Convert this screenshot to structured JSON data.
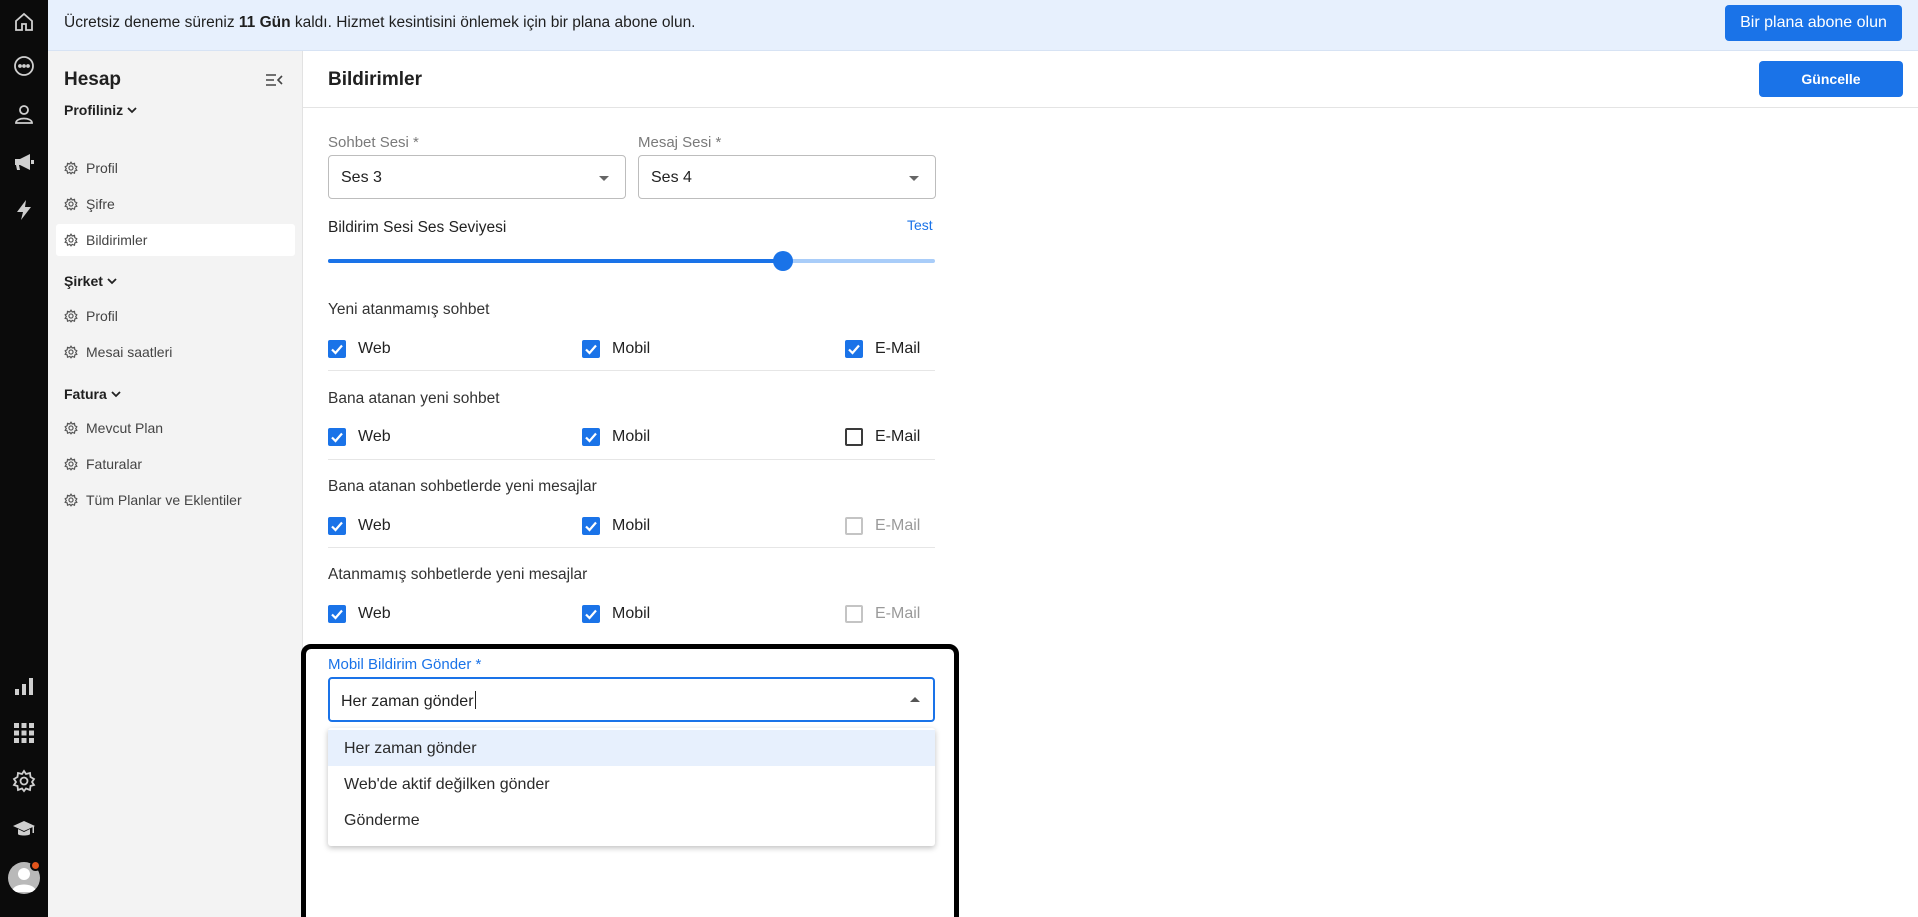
{
  "banner": {
    "text_before": "Ücretsiz deneme süreniz ",
    "days": "11 Gün",
    "text_after": " kaldı. Hizmet kesintisini önlemek için bir plana abone olun.",
    "button": "Bir plana abone olun"
  },
  "rail": {
    "icons": [
      "home-icon",
      "chat-icon",
      "user-icon",
      "megaphone-icon",
      "bolt-icon",
      "bar-chart-icon",
      "apps-grid-icon",
      "settings-gear-icon",
      "graduation-cap-icon",
      "avatar"
    ]
  },
  "sidebar": {
    "title": "Hesap",
    "sections": [
      {
        "label": "Profiliniz",
        "items": [
          "Profil",
          "Şifre",
          "Bildirimler"
        ]
      },
      {
        "label": "Şirket",
        "items": [
          "Profil",
          "Mesai saatleri"
        ]
      },
      {
        "label": "Fatura",
        "items": [
          "Mevcut Plan",
          "Faturalar",
          "Tüm Planlar ve Eklentiler"
        ]
      }
    ],
    "active_item": "Bildirimler"
  },
  "main": {
    "title": "Bildirimler",
    "update_button": "Güncelle",
    "chat_sound": {
      "label": "Sohbet Sesi *",
      "value": "Ses 3"
    },
    "message_sound": {
      "label": "Mesaj Sesi *",
      "value": "Ses 4"
    },
    "volume": {
      "label": "Bildirim Sesi Ses Seviyesi",
      "test_link": "Test",
      "level_fraction": 0.75
    },
    "groups": [
      {
        "title": "Yeni atanmamış sohbet",
        "web": "Web",
        "mobile": "Mobil",
        "email": "E-Mail",
        "web_checked": true,
        "mobile_checked": true,
        "email_state": "checked"
      },
      {
        "title": "Bana atanan yeni sohbet",
        "web": "Web",
        "mobile": "Mobil",
        "email": "E-Mail",
        "web_checked": true,
        "mobile_checked": true,
        "email_state": "unchecked"
      },
      {
        "title": "Bana atanan sohbetlerde yeni mesajlar",
        "web": "Web",
        "mobile": "Mobil",
        "email": "E-Mail",
        "web_checked": true,
        "mobile_checked": true,
        "email_state": "disabled"
      },
      {
        "title": "Atanmamış sohbetlerde yeni mesajlar",
        "web": "Web",
        "mobile": "Mobil",
        "email": "E-Mail",
        "web_checked": true,
        "mobile_checked": true,
        "email_state": "disabled"
      }
    ],
    "mobile_push": {
      "label": "Mobil Bildirim Gönder *",
      "value": "Her zaman gönder",
      "options": [
        "Her zaman gönder",
        "Web'de aktif değilken gönder",
        "Gönderme"
      ],
      "highlighted_option": "Her zaman gönder"
    }
  },
  "colors": {
    "accent": "#1a73e8",
    "banner_bg": "#e7f0fd",
    "rail_bg": "#0b0b0b",
    "sidebar_bg": "#f3f3f3"
  }
}
